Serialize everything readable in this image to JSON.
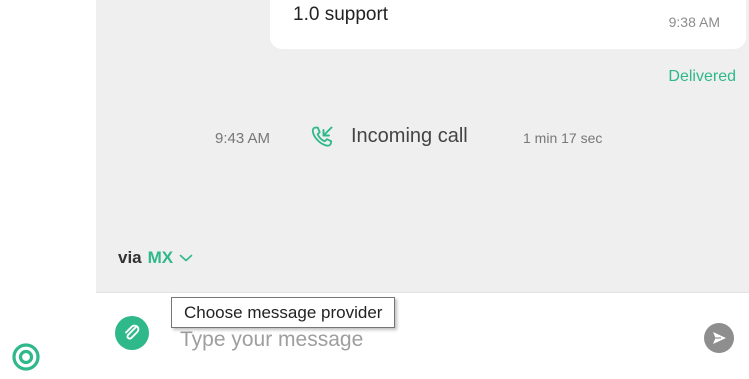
{
  "conversation": {
    "last_message": {
      "text": "1.0 support",
      "time": "9:38 AM",
      "status": "Delivered"
    },
    "call_event": {
      "time": "9:43 AM",
      "label": "Incoming call",
      "duration": "1 min 17 sec",
      "icon": "incoming-call-icon"
    }
  },
  "provider": {
    "via_label": "via",
    "selected": "MX",
    "tooltip": "Choose message provider"
  },
  "composer": {
    "placeholder": "Type your message",
    "value": ""
  },
  "colors": {
    "accent": "#2fb889",
    "chat_background": "#efefef",
    "send_button": "#8e8e8e"
  },
  "icons": {
    "left_rail": "target-icon",
    "attach": "paperclip-icon",
    "send": "send-icon",
    "provider_dropdown": "chevron-down-icon"
  }
}
